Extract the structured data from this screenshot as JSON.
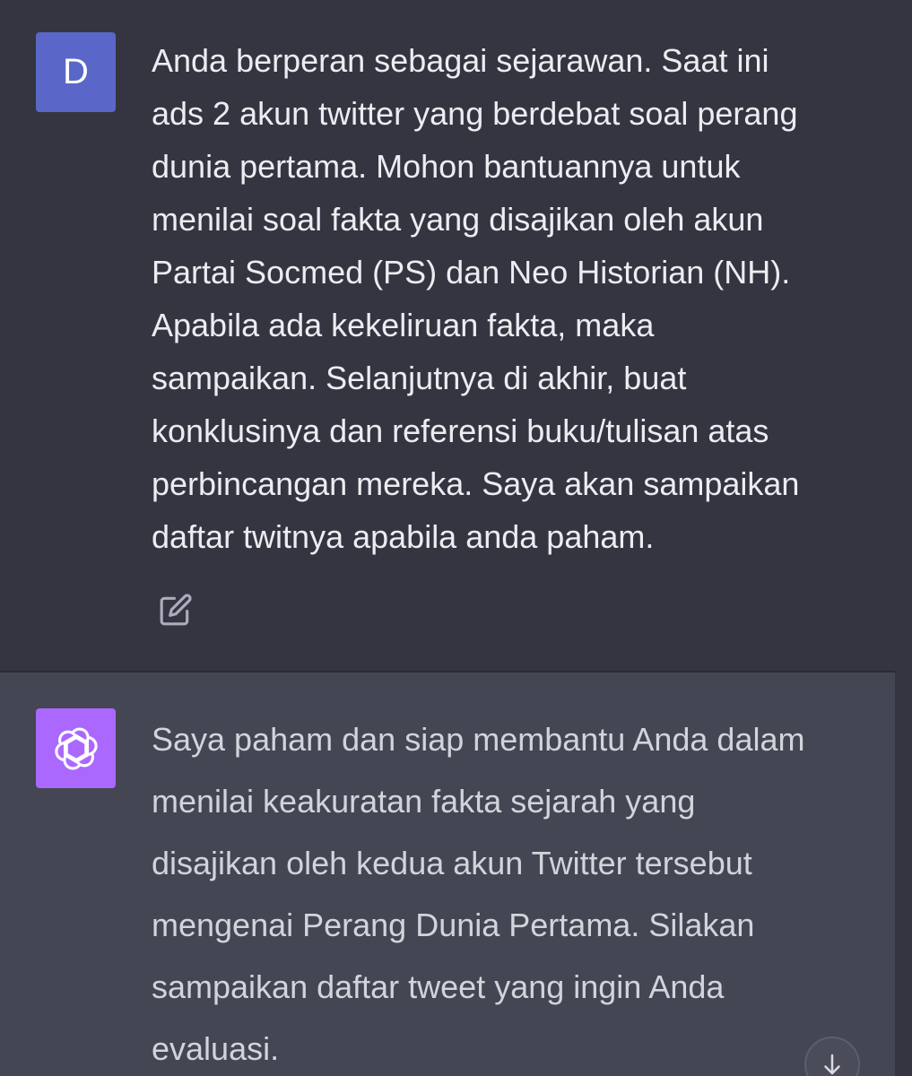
{
  "conversation": {
    "user_message": {
      "avatar_letter": "D",
      "text": "Anda berperan sebagai sejarawan. Saat ini\nads 2 akun twitter yang berdebat soal perang\ndunia pertama. Mohon bantuannya untuk\nmenilai soal fakta yang disajikan oleh akun\nPartai Socmed (PS) dan Neo Historian (NH).\nApabila ada kekeliruan fakta, maka\nsampaikan. Selanjutnya di akhir, buat\nkonklusinya dan referensi buku/tulisan atas\nperbincangan mereka. Saya akan sampaikan\ndaftar twitnya apabila anda paham.",
      "edit_icon": "edit-icon"
    },
    "assistant_message": {
      "avatar_icon": "openai-logo-icon",
      "text": "Saya paham dan siap membantu Anda dalam\nmenilai keakuratan fakta sejarah yang\ndisajikan oleh kedua akun Twitter tersebut\nmengenai Perang Dunia Pertama. Silakan\nsampaikan daftar tweet yang ingin Anda\nevaluasi."
    },
    "scroll_button_icon": "arrow-down-icon"
  },
  "colors": {
    "user_bg": "#343541",
    "assistant_bg": "#444654",
    "user_avatar": "#5a67c8",
    "assistant_avatar": "#ab68ff",
    "user_text": "#ececf1",
    "assistant_text": "#d1d5db"
  }
}
